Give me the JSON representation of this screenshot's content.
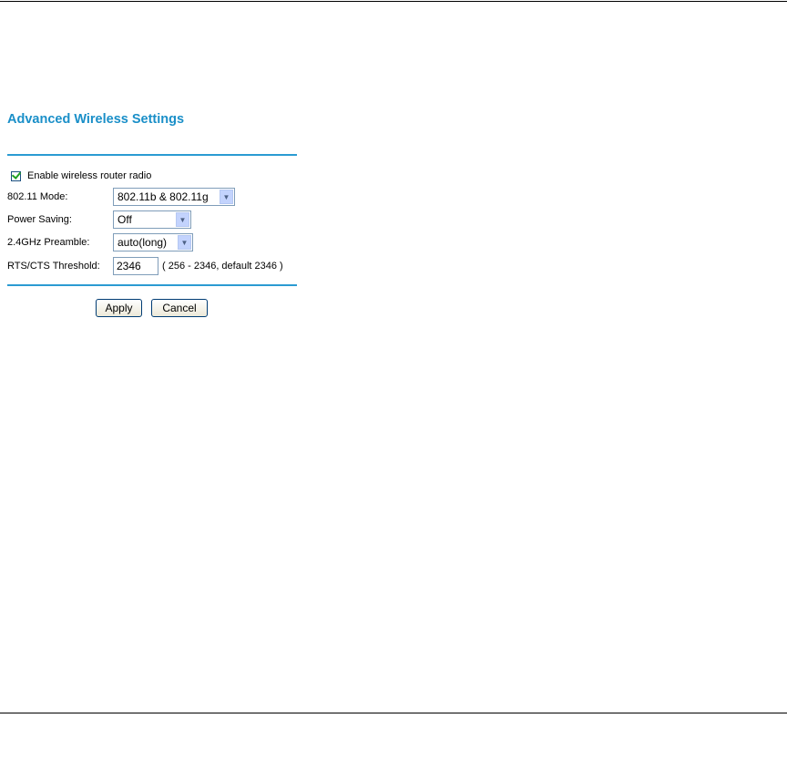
{
  "page": {
    "title": "Advanced Wireless Settings",
    "accent_color": "#1a8fc8"
  },
  "radio": {
    "label": "Enable wireless router radio",
    "checked": true
  },
  "fields": {
    "mode": {
      "label": "802.11 Mode:",
      "value": "802.11b & 802.11g"
    },
    "power": {
      "label": "Power Saving:",
      "value": "Off"
    },
    "preamble": {
      "label": "2.4GHz Preamble:",
      "value": "auto(long)"
    },
    "rts": {
      "label": "RTS/CTS Threshold:",
      "value": "2346",
      "hint": "( 256 - 2346, default 2346 )"
    }
  },
  "buttons": {
    "apply": "Apply",
    "cancel": "Cancel"
  }
}
